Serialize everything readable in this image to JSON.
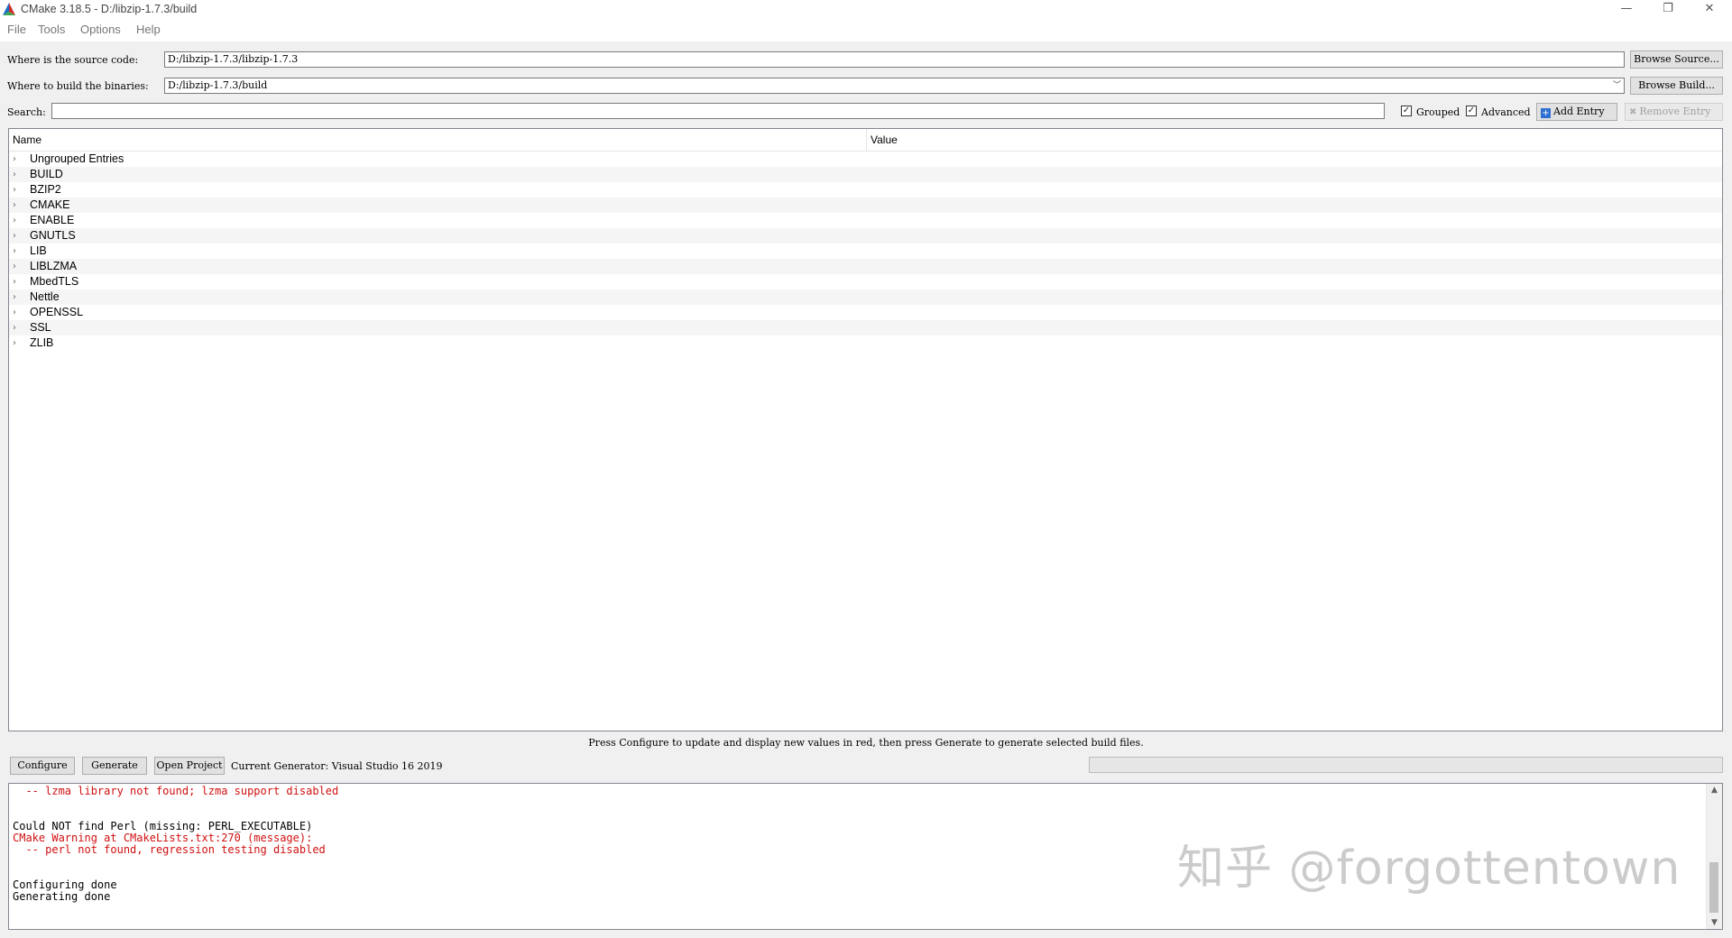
{
  "window": {
    "title": "CMake 3.18.5 - D:/libzip-1.7.3/build",
    "controls": {
      "minimize": "—",
      "restore": "❐",
      "close": "✕"
    }
  },
  "menu": [
    "File",
    "Tools",
    "Options",
    "Help"
  ],
  "source": {
    "label": "Where is the source code:",
    "value": "D:/libzip-1.7.3/libzip-1.7.3",
    "browse_label": "Browse Source..."
  },
  "build": {
    "label": "Where to build the binaries:",
    "value": "D:/libzip-1.7.3/build",
    "browse_label": "Browse Build..."
  },
  "search": {
    "label": "Search:",
    "value": "",
    "grouped_label": "Grouped",
    "grouped_checked": true,
    "advanced_label": "Advanced",
    "advanced_checked": true,
    "add_entry_label": "Add Entry",
    "remove_entry_label": "Remove Entry"
  },
  "tree": {
    "columns": [
      "Name",
      "Value"
    ],
    "groups": [
      "Ungrouped Entries",
      "BUILD",
      "BZIP2",
      "CMAKE",
      "ENABLE",
      "GNUTLS",
      "LIB",
      "LIBLZMA",
      "MbedTLS",
      "Nettle",
      "OPENSSL",
      "SSL",
      "ZLIB"
    ]
  },
  "hint": "Press Configure to update and display new values in red, then press Generate to generate selected build files.",
  "actions": {
    "configure": "Configure",
    "generate": "Generate",
    "open_project": "Open Project",
    "generator": "Current Generator: Visual Studio 16 2019"
  },
  "output": {
    "lines": [
      {
        "text": "  -- lzma library not found; lzma support disabled",
        "color": "#d01010"
      },
      {
        "text": "",
        "color": "#000000"
      },
      {
        "text": "",
        "color": "#000000"
      },
      {
        "text": "Could NOT find Perl (missing: PERL_EXECUTABLE)",
        "color": "#000000"
      },
      {
        "text": "CMake Warning at CMakeLists.txt:270 (message):",
        "color": "#d01010"
      },
      {
        "text": "  -- perl not found, regression testing disabled",
        "color": "#d01010"
      },
      {
        "text": "",
        "color": "#000000"
      },
      {
        "text": "",
        "color": "#000000"
      },
      {
        "text": "Configuring done",
        "color": "#000000"
      },
      {
        "text": "Generating done",
        "color": "#000000"
      }
    ]
  },
  "watermark": "知乎 @forgottentown"
}
